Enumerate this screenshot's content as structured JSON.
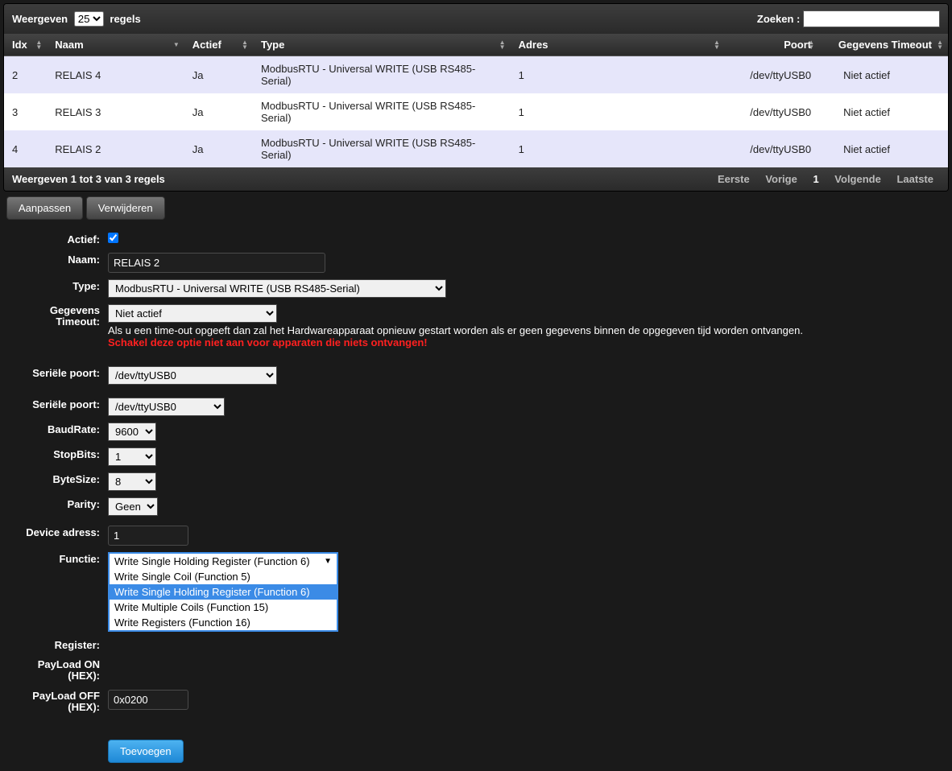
{
  "toolbar": {
    "show_prefix": "Weergeven",
    "show_count": "25",
    "show_suffix": "regels",
    "search_label": "Zoeken :"
  },
  "columns": {
    "idx": "Idx",
    "naam": "Naam",
    "actief": "Actief",
    "type": "Type",
    "adres": "Adres",
    "poort": "Poort",
    "timeout": "Gegevens Timeout"
  },
  "rows": [
    {
      "idx": "2",
      "naam": "RELAIS 4",
      "actief": "Ja",
      "type": "ModbusRTU - Universal WRITE (USB RS485-Serial)",
      "adres": "1",
      "poort": "/dev/ttyUSB0",
      "timeout": "Niet actief"
    },
    {
      "idx": "3",
      "naam": "RELAIS 3",
      "actief": "Ja",
      "type": "ModbusRTU - Universal WRITE (USB RS485-Serial)",
      "adres": "1",
      "poort": "/dev/ttyUSB0",
      "timeout": "Niet actief"
    },
    {
      "idx": "4",
      "naam": "RELAIS 2",
      "actief": "Ja",
      "type": "ModbusRTU - Universal WRITE (USB RS485-Serial)",
      "adres": "1",
      "poort": "/dev/ttyUSB0",
      "timeout": "Niet actief"
    }
  ],
  "footer": {
    "summary": "Weergeven 1 tot 3 van 3 regels",
    "first": "Eerste",
    "prev": "Vorige",
    "page": "1",
    "next": "Volgende",
    "last": "Laatste"
  },
  "buttons": {
    "edit": "Aanpassen",
    "delete": "Verwijderen",
    "add": "Toevoegen"
  },
  "form": {
    "actief_label": "Actief:",
    "naam_label": "Naam:",
    "naam_value": "RELAIS 2",
    "type_label": "Type:",
    "type_value": "ModbusRTU - Universal WRITE (USB RS485-Serial)",
    "timeout_label": "Gegevens Timeout:",
    "timeout_value": "Niet actief",
    "timeout_hint": "Als u een time-out opgeeft dan zal het Hardwareapparaat opnieuw gestart worden als er geen gegevens binnen de opgegeven tijd worden ontvangen.",
    "timeout_warn": "Schakel deze optie niet aan voor apparaten die niets ontvangen!",
    "serial_label": "Seriële poort:",
    "serial_value": "/dev/ttyUSB0",
    "serial2_label": "Seriële poort:",
    "serial2_value": "/dev/ttyUSB0",
    "baud_label": "BaudRate:",
    "baud_value": "9600",
    "stop_label": "StopBits:",
    "stop_value": "1",
    "bytesize_label": "ByteSize:",
    "bytesize_value": "8",
    "parity_label": "Parity:",
    "parity_value": "Geen",
    "devadr_label": "Device adress:",
    "devadr_value": "1",
    "functie_label": "Functie:",
    "functie_selected": "Write Single Holding Register (Function 6)",
    "functie_options": [
      "Write Single Coil (Function 5)",
      "Write Single Holding Register (Function 6)",
      "Write Multiple Coils (Function 15)",
      "Write Registers (Function 16)"
    ],
    "register_label": "Register:",
    "payload_on_label": "PayLoad ON (HEX):",
    "payload_off_label": "PayLoad OFF (HEX):",
    "payload_off_value": "0x0200"
  }
}
